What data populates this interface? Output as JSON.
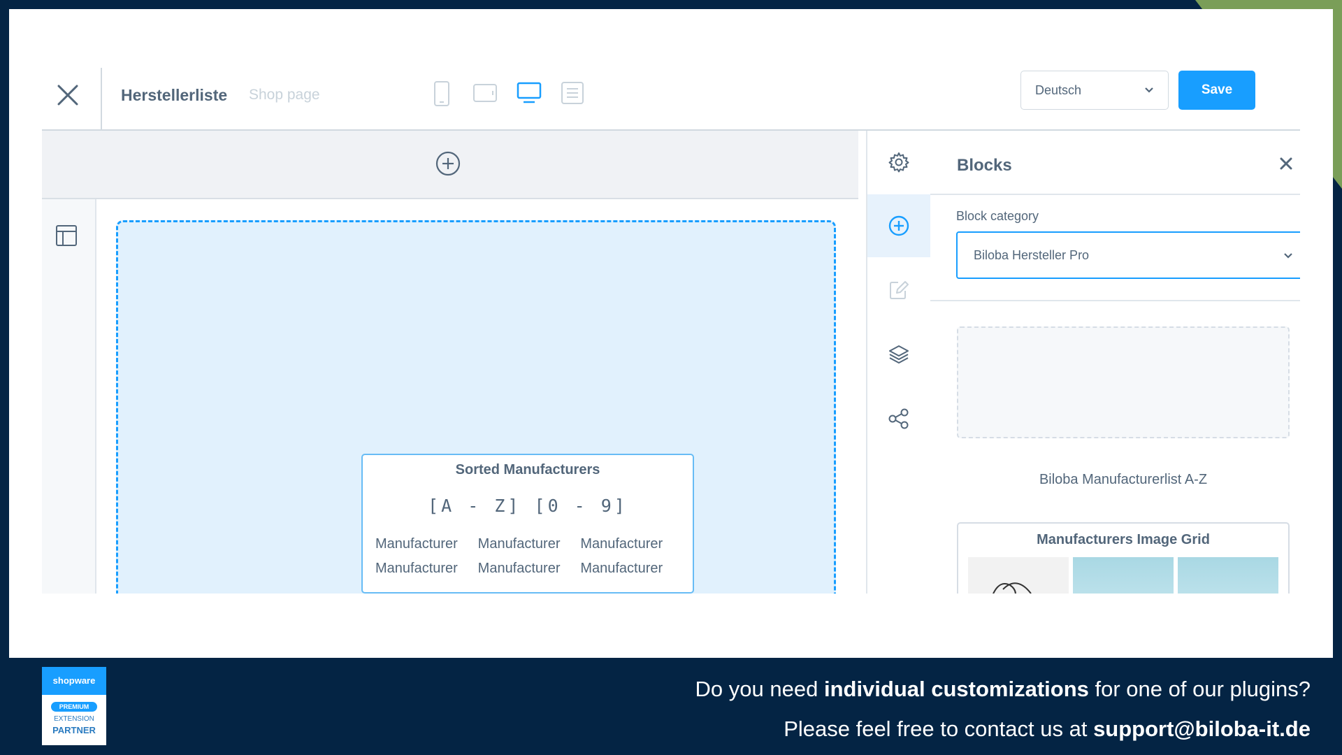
{
  "colors": {
    "accent": "#189eff",
    "background": "#042444",
    "text": "#52667a",
    "corner": "#7a9e58"
  },
  "toolbar": {
    "title": "Herstellerliste",
    "subtitle": "Shop page",
    "devices": [
      "mobile-icon",
      "tablet-icon",
      "desktop-icon",
      "form-icon"
    ],
    "active_device": "desktop",
    "language": "Deutsch",
    "save_label": "Save"
  },
  "sidebar_tabs": [
    "settings-icon",
    "add-block-icon",
    "edit-icon",
    "layers-icon",
    "share-icon"
  ],
  "preview": {
    "title": "Sorted Manufacturers",
    "range": "[A - Z] [0 - 9]",
    "items": [
      "Manufacturer",
      "Manufacturer",
      "Manufacturer",
      "Manufacturer",
      "Manufacturer",
      "Manufacturer"
    ]
  },
  "blocks_panel": {
    "title": "Blocks",
    "category_label": "Block category",
    "category_value": "Biloba Hersteller Pro",
    "blocks": [
      {
        "label": "Biloba Manufacturerlist A-Z"
      },
      {
        "title": "Manufacturers Image Grid"
      }
    ]
  },
  "badge": {
    "brand": "shopware",
    "tier": "PREMIUM",
    "line2": "EXTENSION",
    "line3": "PARTNER"
  },
  "footer": {
    "line1_pre": "Do you need ",
    "line1_bold": "individual customizations",
    "line1_post": " for one of our plugins?",
    "line2_pre": "Please feel free to contact us at ",
    "line2_bold": "support@biloba-it.de"
  }
}
